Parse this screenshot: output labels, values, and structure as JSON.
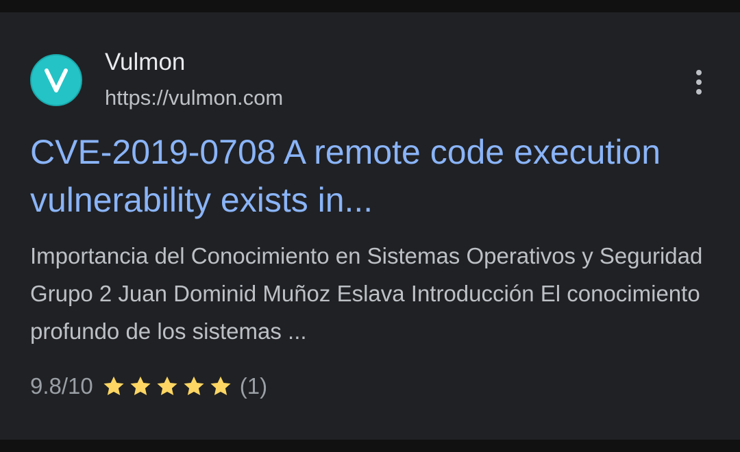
{
  "result": {
    "site_name": "Vulmon",
    "site_url": "https://vulmon.com",
    "favicon_letter": "V",
    "favicon_color": "#24c3c6",
    "menu_icon": "more-vert-icon",
    "title": "CVE-2019-0708 A remote code execution vulnerability exists in...",
    "title_color": "#8ab4f8",
    "snippet": "Importancia del Conocimiento en Sistemas Operativos y Seguridad Grupo 2 Juan Dominid Muñoz Eslava Introducción El conocimiento profundo de los sistemas ...",
    "rating": {
      "score_text": "9.8/10",
      "stars_filled": 5,
      "stars_total": 5,
      "star_color": "#fdd663",
      "count_text": "(1)"
    }
  }
}
